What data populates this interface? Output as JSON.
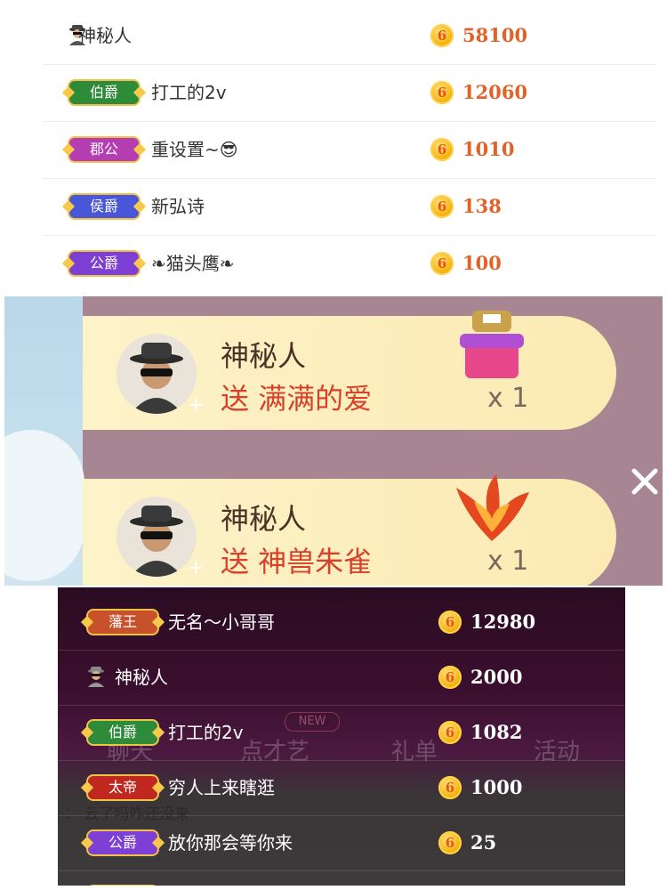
{
  "colors": {
    "score_orange": "#e0642a",
    "gift_red": "#d8402a",
    "coin_gold": "#f5b313"
  },
  "panel_top": {
    "rows": [
      {
        "badge": "",
        "icon": "spy-icon",
        "name": "神秘人",
        "score": "58100"
      },
      {
        "badge": "伯爵",
        "badge_color": "#2e8b3a",
        "name": "打工的2v",
        "score": "12060"
      },
      {
        "badge": "郡公",
        "badge_color": "#b33db1",
        "name": "重设置~😎",
        "score": "1010"
      },
      {
        "badge": "侯爵",
        "badge_color": "#4a56d8",
        "name": "新弘诗",
        "score": "138"
      },
      {
        "badge": "公爵",
        "badge_color": "#7d3fd4",
        "name": "❧猫头鹰❧",
        "score": "100"
      }
    ]
  },
  "panel_gifts": {
    "gifts": [
      {
        "sender": "神秘人",
        "text": "送 满满的爱",
        "qty": "x 1",
        "gift_icon": "gift-box-icon"
      },
      {
        "sender": "神秘人",
        "text": "送 神兽朱雀",
        "qty": "x 1",
        "gift_icon": "phoenix-icon"
      }
    ],
    "close_icon": "close-icon"
  },
  "panel_bottom": {
    "rows": [
      {
        "badge": "藩王",
        "badge_color": "#c7512a",
        "name": "无名～小哥哥",
        "score": "12980"
      },
      {
        "badge": "",
        "icon": "spy-icon",
        "name": "神秘人",
        "score": "2000"
      },
      {
        "badge": "伯爵",
        "badge_color": "#2e8b3a",
        "name": "打工的2v",
        "score": "1082"
      },
      {
        "badge": "太帝",
        "badge_color": "#c0271f",
        "name": "穷人上来瞎逛",
        "score": "1000"
      },
      {
        "badge": "公爵",
        "badge_color": "#7d3fd4",
        "name": "放你那会等你来",
        "score": "25"
      }
    ],
    "ghost_tabs": [
      "聊天",
      "点才艺",
      "礼单",
      "活动"
    ],
    "ghost_new": "NEW",
    "chat_line": "：  云了吗咋还没来"
  }
}
